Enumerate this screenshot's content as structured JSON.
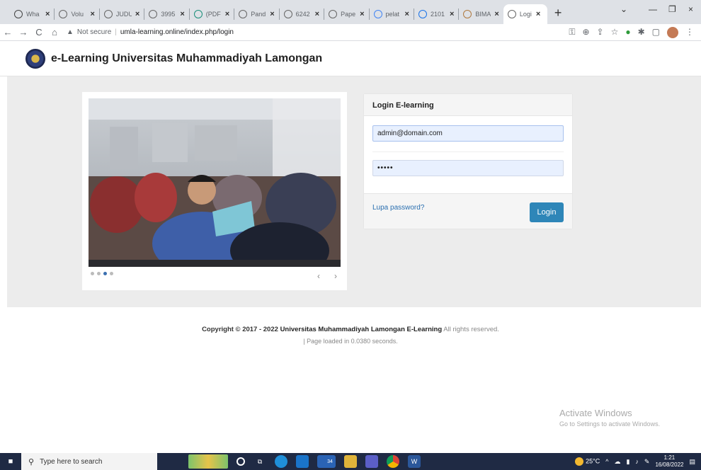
{
  "browser": {
    "tabs": [
      {
        "title": "Wha",
        "icon": "chatgpt-icon"
      },
      {
        "title": "Volu",
        "icon": "globe-icon"
      },
      {
        "title": "JUDU",
        "icon": "globe-icon"
      },
      {
        "title": "3995",
        "icon": "globe-icon"
      },
      {
        "title": "(PDF",
        "icon": "pdf-icon"
      },
      {
        "title": "Pand",
        "icon": "globe-icon"
      },
      {
        "title": "6242",
        "icon": "globe-icon"
      },
      {
        "title": "Pape",
        "icon": "globe-icon"
      },
      {
        "title": "pelat",
        "icon": "google-icon"
      },
      {
        "title": "2101",
        "icon": "doc-icon"
      },
      {
        "title": "BIMA",
        "icon": "avatar-icon"
      },
      {
        "title": "Logi",
        "icon": "globe-icon",
        "active": true
      }
    ],
    "address": {
      "security": "Not secure",
      "url": "umla-learning.online/index.php/login"
    }
  },
  "site": {
    "title": "e-Learning Universitas Muhammadiyah Lamongan"
  },
  "slider": {
    "slide_count": 4,
    "active_index": 2,
    "prev_label": "‹",
    "next_label": "›"
  },
  "login": {
    "heading": "Login E-learning",
    "username_value": "admin@domain.com",
    "password_value": "•••••",
    "forgot_label": "Lupa password?",
    "submit_label": "Login",
    "colors": {
      "button": "#2e86b8",
      "link": "#2a6fb0"
    }
  },
  "footer": {
    "copyright_prefix": "Copyright © 2017 - 2022",
    "org": "Universitas Muhammadiyah Lamongan E-Learning",
    "rights": "All rights reserved.",
    "loaded": "| Page loaded in 0.0380 seconds."
  },
  "watermark": {
    "line1": "Activate Windows",
    "line2": "Go to Settings to activate Windows."
  },
  "taskbar": {
    "search_placeholder": "Type here to search",
    "weather": "25°C",
    "time": "1:21",
    "date": "16/08/2022",
    "badge": "34"
  }
}
